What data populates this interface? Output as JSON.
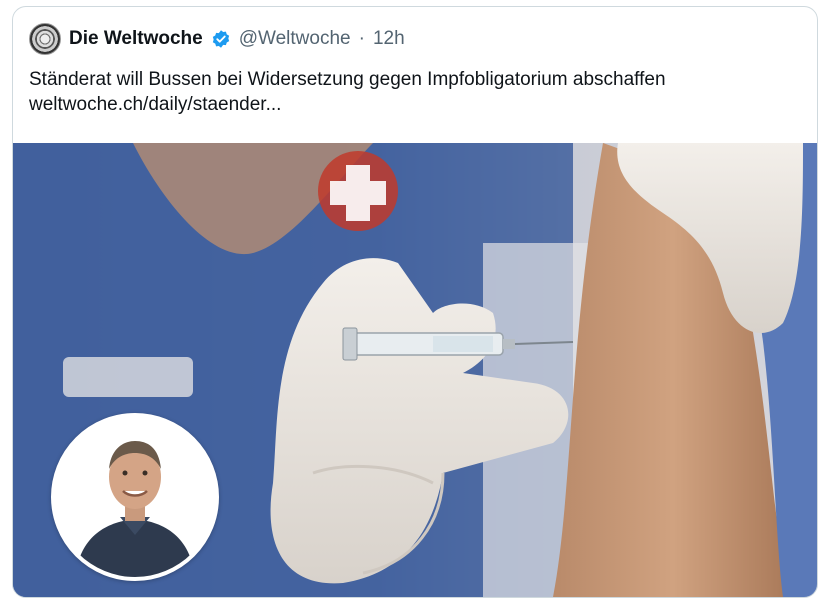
{
  "tweet": {
    "author_name": "Die Weltwoche",
    "handle": "@Weltwoche",
    "separator": "·",
    "time": "12h",
    "text_line1": "Ständerat will Bussen bei Widersetzung gegen Impfobligatorium abschaffen",
    "text_line2": "weltwoche.ch/daily/staender..."
  },
  "icons": {
    "verified": "verified-badge-icon",
    "avatar": "weltwoche-logo"
  },
  "colors": {
    "verified_blue": "#1d9bf0",
    "text_primary": "#0f1419",
    "text_secondary": "#536471",
    "scrub_blue": "#3f5f9c"
  }
}
